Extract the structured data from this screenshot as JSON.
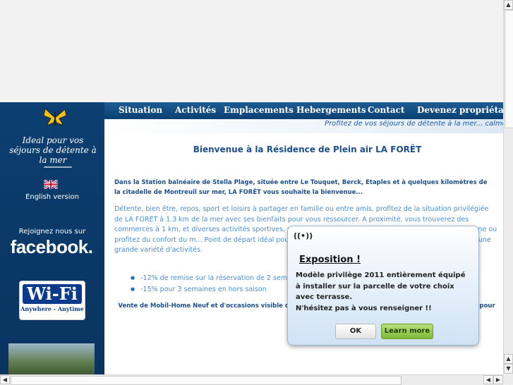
{
  "nav": {
    "items": [
      "Situation",
      "Activités",
      "Emplacements",
      "Hebergements",
      "Contact",
      "Devenez propriétaire"
    ]
  },
  "tagline": "Profitez de vos séjours de détente à la mer... calme et",
  "sidebar": {
    "slogan": "Ideal pour vos séjours de détente à la mer",
    "english_version": "English version",
    "join_us": "Rejoignez nous sur",
    "facebook": "facebook.",
    "wifi_title": "Wi-Fi",
    "wifi_subtitle": "Anywhere - Anytime"
  },
  "content": {
    "welcome": "Bienvenue à la Résidence de Plein air LA FORÊT",
    "intro": "Dans la Station balnéaire de Stella Plage, située entre Le Touquet, Berck, Etaples et à quelques kilomètres de la citadelle de Montreuil sur mer, LA FORÊT vous souhaite la bienvenue...",
    "paragraph": "Détente, bien être, repos, sport et loisirs à partager en famille ou entre amis, profitez de la situation privilégiée de LA FORET à 1.3 km de la mer avec ses bienfaits pour vous ressourcer. A proximité, vous trouverez des commerces à 1 km, et diverses activités sportives, randonnées pédestres, péd... Séjournez en tente, caravane ou profitez du confort du m... Point de départ idéal pour toutes les curiosités de la Côt... plage de sable fin et d'une grande variété d'activités.",
    "bullets": [
      "-12% de remise sur la réservation de 2 semaine...",
      "-15% pour 3 semaines en hors saison"
    ],
    "mobil": "Vente de Mobil-Home Neuf et d'occasions visible da... N'hésitez pas à vous renseigner !! ...nous contacter pour tout re..."
  },
  "popup": {
    "title": "Exposition !",
    "body": "Modèle privilège 2011 entièrement équipé à installer sur la parcelle de votre choix avec terrasse.",
    "body2": "N'hésitez pas à vous renseigner !!",
    "ok": "OK",
    "more": "Learn more"
  },
  "colors": {
    "nav_bg": "#0c3f72",
    "sidebar_bg": "#0b3a69",
    "heading_text": "#1d4f8c",
    "body_text": "#4a8fd0",
    "learn_more_bg": "#7cb93a"
  }
}
